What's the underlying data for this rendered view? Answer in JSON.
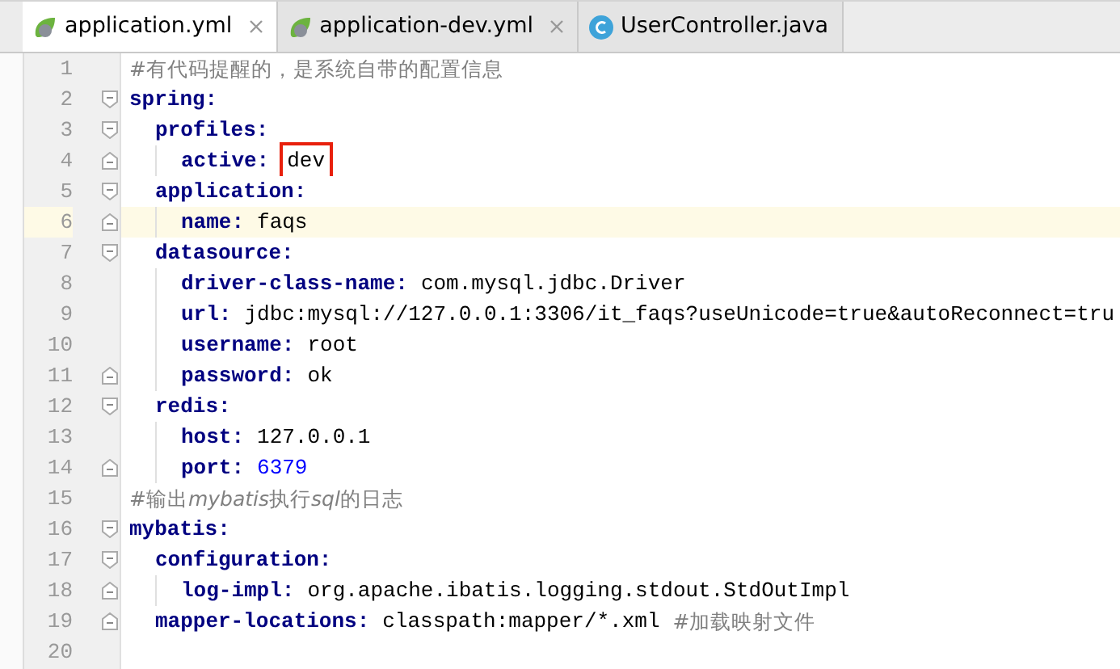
{
  "tabs": [
    {
      "label": "application.yml",
      "kind": "spring",
      "selected": true,
      "closable": true
    },
    {
      "label": "application-dev.yml",
      "kind": "spring",
      "selected": false,
      "closable": true
    },
    {
      "label": "UserController.java",
      "kind": "class",
      "selected": false,
      "closable": false
    }
  ],
  "editor": {
    "lines": [
      {
        "line": "1",
        "kind": "comment",
        "current": false,
        "parts": [
          {
            "text": "#有代码提醒的，是系统自带的配置信息",
            "italic": false
          }
        ]
      },
      {
        "line": "2",
        "kind": "entry",
        "key": "spring:",
        "current": false,
        "children": [
          {
            "line": "3",
            "kind": "entry",
            "key": "profiles:",
            "current": false,
            "children": [
              {
                "line": "4",
                "kind": "entry",
                "key": "active:",
                "value": {
                  "text": "dev",
                  "kind": "string",
                  "boxed": true
                },
                "current": false
              }
            ]
          },
          {
            "line": "5",
            "kind": "entry",
            "key": "application:",
            "current": false,
            "children": [
              {
                "line": "6",
                "kind": "entry",
                "key": "name:",
                "value": {
                  "text": "faqs",
                  "kind": "string",
                  "boxed": false
                },
                "current": true
              }
            ]
          },
          {
            "line": "7",
            "kind": "entry",
            "key": "datasource:",
            "current": false,
            "children": [
              {
                "line": "8",
                "kind": "entry",
                "key": "driver-class-name:",
                "value": {
                  "text": "com.mysql.jdbc.Driver",
                  "kind": "string",
                  "boxed": false
                },
                "current": false
              },
              {
                "line": "9",
                "kind": "entry",
                "key": "url:",
                "value": {
                  "text": "jdbc:mysql://127.0.0.1:3306/it_faqs?useUnicode=true&autoReconnect=tru",
                  "kind": "string",
                  "boxed": false
                },
                "current": false
              },
              {
                "line": "10",
                "kind": "entry",
                "key": "username:",
                "value": {
                  "text": "root",
                  "kind": "string",
                  "boxed": false
                },
                "current": false
              },
              {
                "line": "11",
                "kind": "entry",
                "key": "password:",
                "value": {
                  "text": "ok",
                  "kind": "string",
                  "boxed": false
                },
                "current": false
              }
            ]
          },
          {
            "line": "12",
            "kind": "entry",
            "key": "redis:",
            "current": false,
            "children": [
              {
                "line": "13",
                "kind": "entry",
                "key": "host:",
                "value": {
                  "text": "127.0.0.1",
                  "kind": "string",
                  "boxed": false
                },
                "current": false
              },
              {
                "line": "14",
                "kind": "entry",
                "key": "port:",
                "value": {
                  "text": "6379",
                  "kind": "number",
                  "boxed": false
                },
                "current": false
              }
            ]
          }
        ]
      },
      {
        "line": "15",
        "kind": "comment",
        "current": false,
        "parts": [
          {
            "text": "#输出",
            "italic": false
          },
          {
            "text": "mybatis",
            "italic": true
          },
          {
            "text": "执行",
            "italic": false
          },
          {
            "text": "sql",
            "italic": true
          },
          {
            "text": "的日志",
            "italic": false
          }
        ]
      },
      {
        "line": "16",
        "kind": "entry",
        "key": "mybatis:",
        "current": false,
        "children": [
          {
            "line": "17",
            "kind": "entry",
            "key": "configuration:",
            "current": false,
            "children": [
              {
                "line": "18",
                "kind": "entry",
                "key": "log-impl:",
                "value": {
                  "text": "org.apache.ibatis.logging.stdout.StdOutImpl",
                  "kind": "string",
                  "boxed": false
                },
                "current": false
              }
            ]
          },
          {
            "line": "19",
            "kind": "entry",
            "key": "mapper-locations:",
            "value": {
              "text": "classpath:mapper/*.xml",
              "kind": "string",
              "boxed": false
            },
            "comment": "#加载映射文件",
            "current": false
          }
        ]
      },
      {
        "line": "20",
        "kind": "blank",
        "current": false
      }
    ]
  }
}
